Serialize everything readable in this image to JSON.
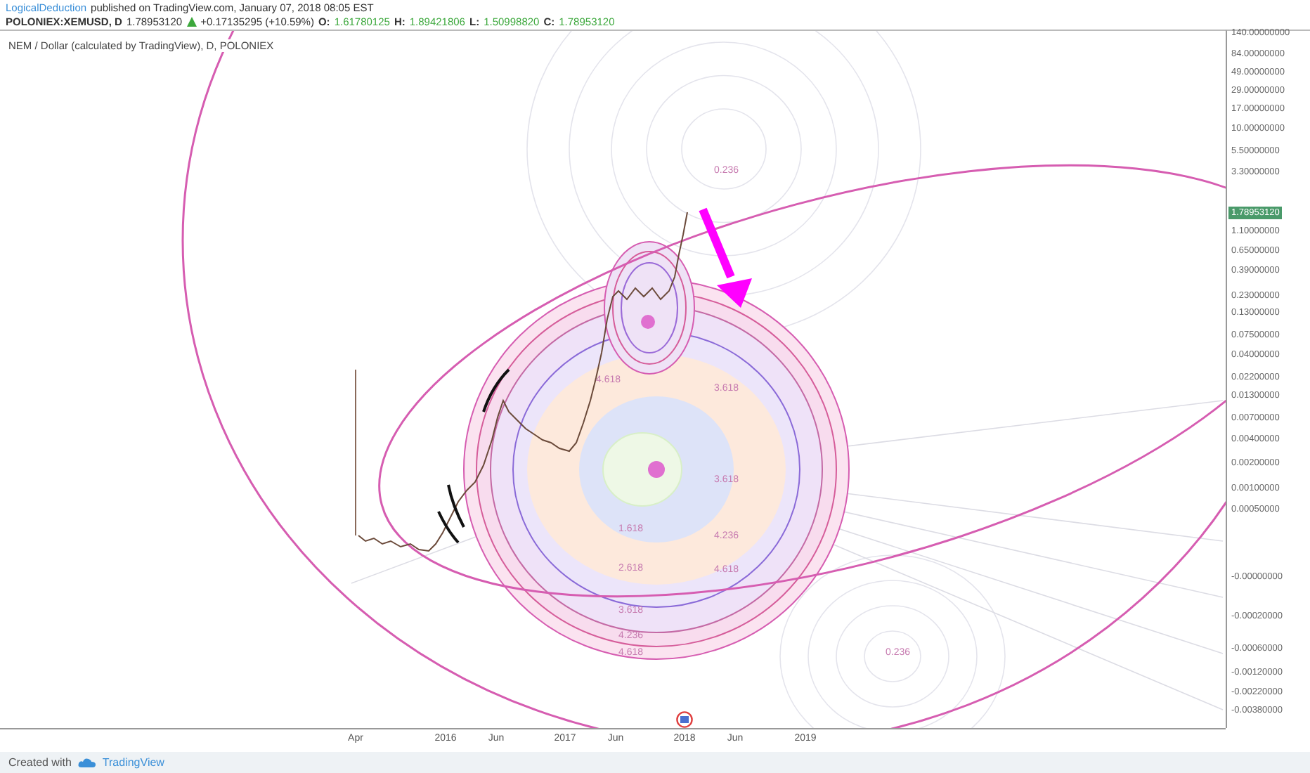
{
  "header": {
    "author": "LogicalDeduction",
    "published": "published on TradingView.com, January 07, 2018 08:05 EST",
    "symbol": "POLONIEX:XEMUSD, D",
    "last": "1.78953120",
    "price_up": true,
    "change": "+0.17135295 (+10.59%)",
    "ohlc": [
      {
        "label": "O:",
        "value": "1.61780125"
      },
      {
        "label": "H:",
        "value": "1.89421806"
      },
      {
        "label": "L:",
        "value": "1.50998820"
      },
      {
        "label": "C:",
        "value": "1.78953120"
      }
    ]
  },
  "chart": {
    "title": "NEM / Dollar (calculated by TradingView), D, POLONIEX",
    "fib_labels": [
      "0.236",
      "4.618",
      "3.618",
      "3.618",
      "1.618",
      "4.236",
      "2.618",
      "4.618",
      "3.618",
      "4.236",
      "4.618",
      "0.236"
    ]
  },
  "price_axis": {
    "ticks": [
      "140.00000000",
      "84.00000000",
      "49.00000000",
      "29.00000000",
      "17.00000000",
      "10.00000000",
      "5.50000000",
      "3.30000000",
      "1.10000000",
      "0.65000000",
      "0.39000000",
      "0.23000000",
      "0.13000000",
      "0.07500000",
      "0.04000000",
      "0.02200000",
      "0.01300000",
      "0.00700000",
      "0.00400000",
      "0.00200000",
      "0.00100000",
      "0.00050000",
      "-0.00000000",
      "-0.00020000",
      "-0.00060000",
      "-0.00120000",
      "-0.00220000",
      "-0.00380000"
    ],
    "price_badge": "1.78953120"
  },
  "time_axis": {
    "ticks": [
      "Apr",
      "2016",
      "Jun",
      "2017",
      "Jun",
      "2018",
      "Jun",
      "2019"
    ]
  },
  "footer": {
    "text": "Created with",
    "brand": "TradingView"
  }
}
